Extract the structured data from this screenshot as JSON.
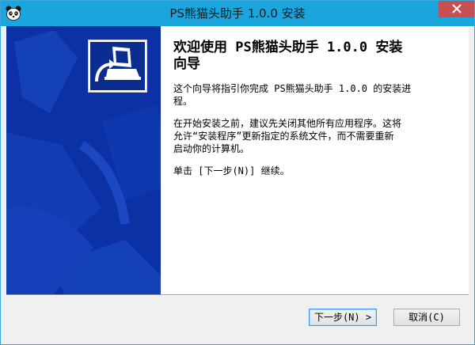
{
  "window": {
    "title": "PS熊猫头助手 1.0.0 安装",
    "app_icon": "panda-icon",
    "close_icon": "close-icon"
  },
  "wizard": {
    "heading_line1": "欢迎使用 PS熊猫头助手 1.0.0 安装",
    "heading_line2": "向导",
    "paragraph1_line1": "这个向导将指引你完成 PS熊猫头助手 1.0.0 的安装进",
    "paragraph1_line2": "程。",
    "paragraph2_line1": "在开始安装之前，建议先关闭其他所有应用程序。这将",
    "paragraph2_line2": "允许“安装程序”更新指定的系统文件，而不需要重新",
    "paragraph2_line3": "启动你的计算机。",
    "paragraph3": "单击 [下一步(N)] 继续。",
    "installer_logo_icon": "installer-computer-icon"
  },
  "buttons": {
    "next_label": "下一步(N) >",
    "cancel_label": "取消(C)"
  },
  "colors": {
    "titlebar": "#1aa6dd",
    "side_panel": "#0b31a4",
    "close_button": "#c74f4f"
  }
}
